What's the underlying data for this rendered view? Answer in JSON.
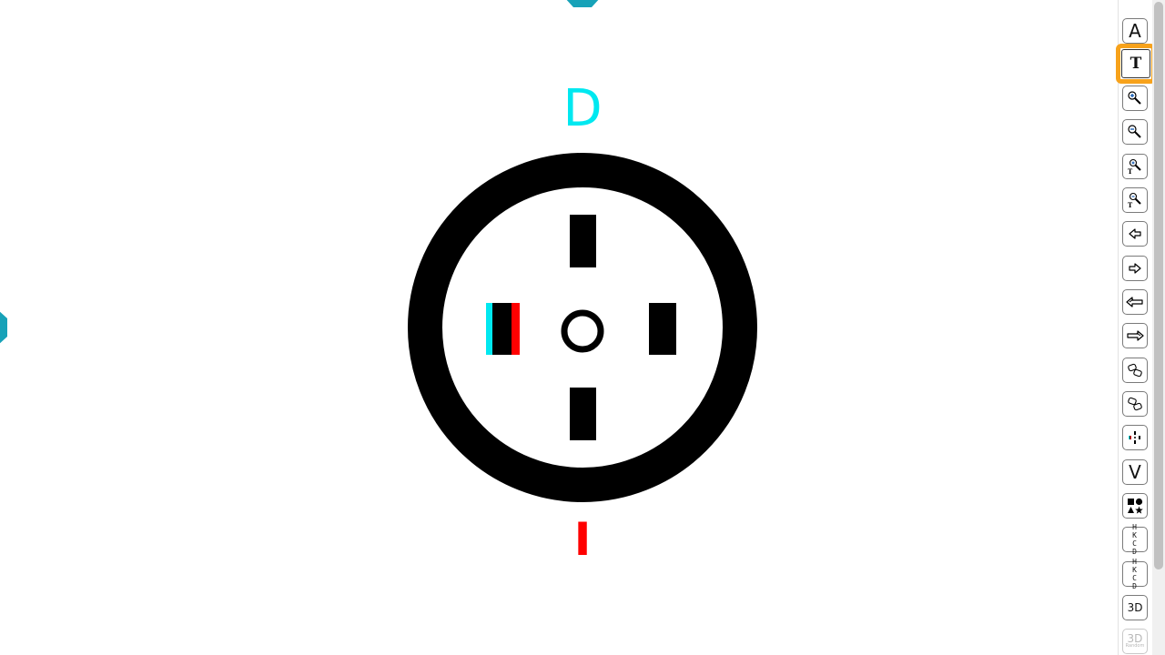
{
  "chart": {
    "letter_top": "D",
    "letter_bottom": "I"
  },
  "colors": {
    "cyan": "#00e8f0",
    "red": "#ff0000",
    "black": "#000000",
    "nav_teal": "#17a2b8",
    "active_orange": "#f7a21b"
  },
  "toolbar": {
    "active_index": 1,
    "buttons": [
      {
        "label": "A",
        "icon": "letter-a-icon"
      },
      {
        "label": "T",
        "icon": "letter-t-icon"
      },
      {
        "label": "",
        "icon": "zoom-in-icon"
      },
      {
        "label": "",
        "icon": "zoom-out-icon"
      },
      {
        "label": "",
        "icon": "zoom-in-text-icon"
      },
      {
        "label": "",
        "icon": "zoom-out-text-icon"
      },
      {
        "label": "",
        "icon": "arrow-left-icon"
      },
      {
        "label": "",
        "icon": "arrow-right-icon"
      },
      {
        "label": "",
        "icon": "double-arrow-left-icon"
      },
      {
        "label": "",
        "icon": "double-arrow-right-icon"
      },
      {
        "label": "",
        "icon": "rotate-ccw-icon"
      },
      {
        "label": "",
        "icon": "rotate-cw-icon"
      },
      {
        "label": "",
        "icon": "worth-dots-icon"
      },
      {
        "label": "V",
        "icon": "letter-v-icon"
      },
      {
        "label": "",
        "icon": "shapes-icon"
      },
      {
        "label": "H K C D",
        "icon": "hkcd-cursor-icon"
      },
      {
        "label": "H K C D",
        "icon": "hkcd-icon"
      },
      {
        "label": "3D",
        "icon": "3d-icon"
      },
      {
        "label": "3D",
        "sub": "Random",
        "icon": "3d-random-icon",
        "disabled": true
      }
    ]
  }
}
